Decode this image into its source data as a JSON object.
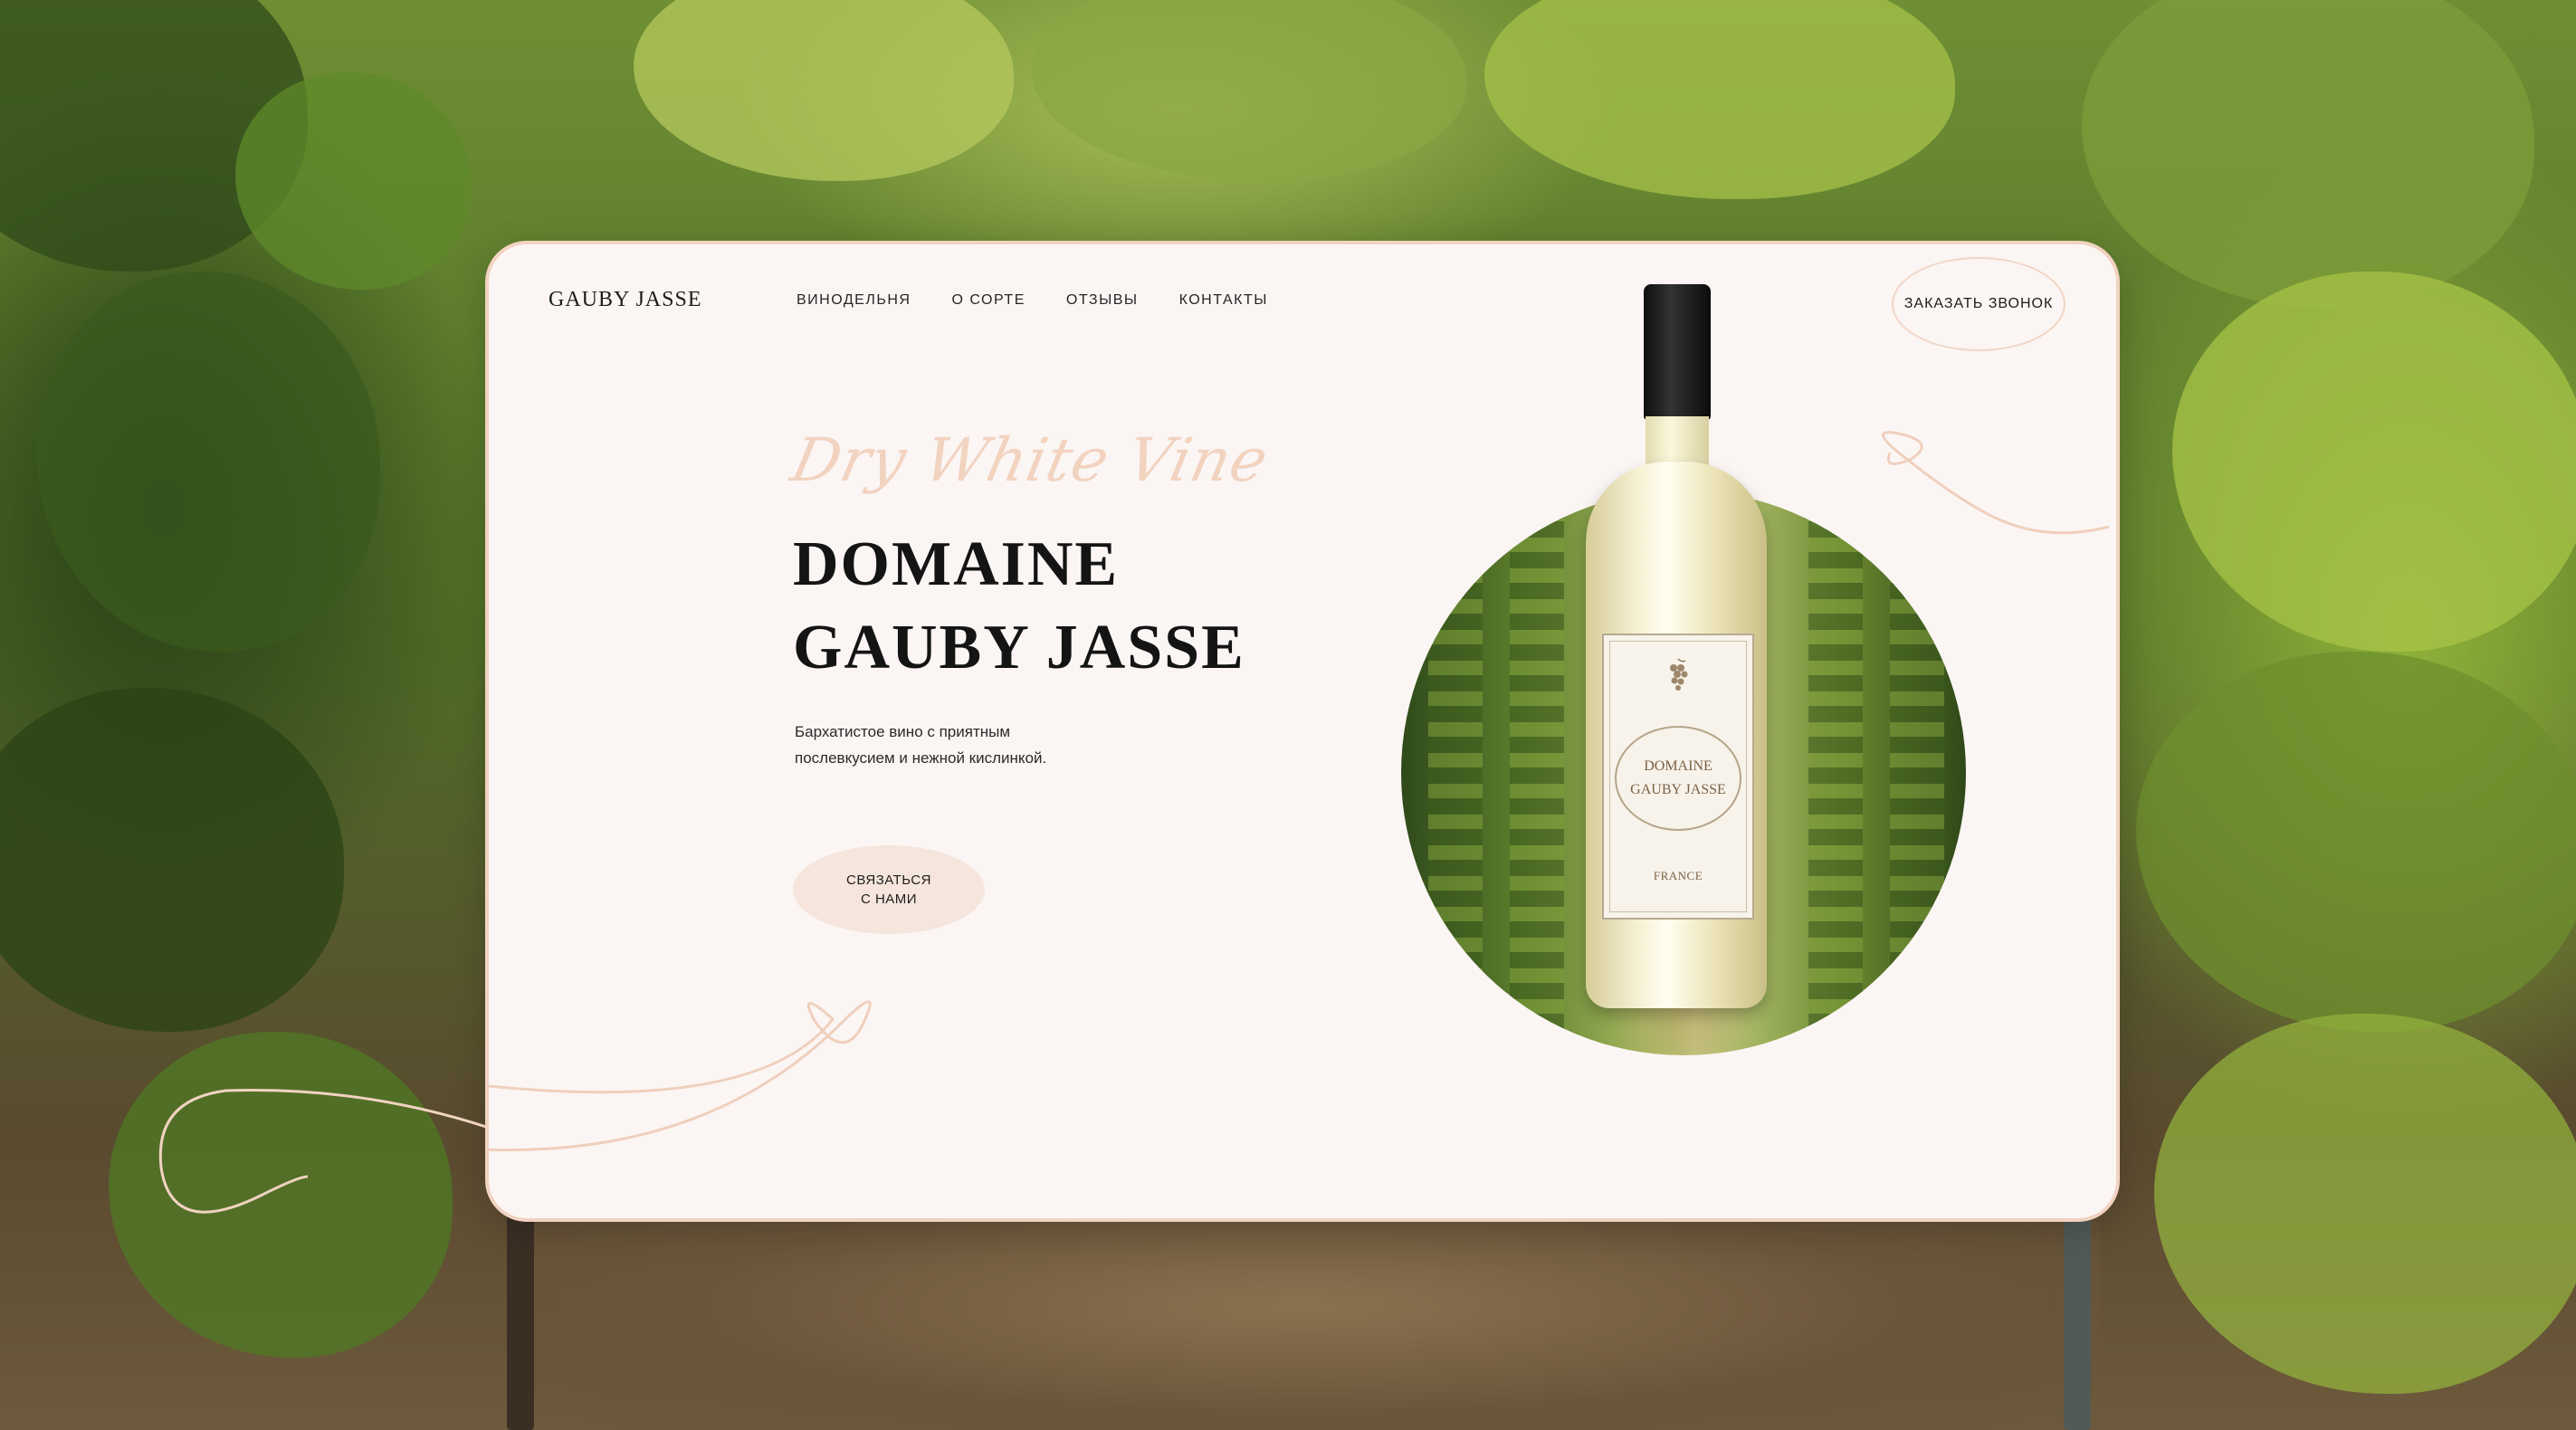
{
  "header": {
    "brand": "GAUBY JASSE",
    "nav": [
      "ВИНОДЕЛЬНЯ",
      "О СОРТЕ",
      "ОТЗЫВЫ",
      "КОНТАКТЫ"
    ],
    "call_button": "ЗАКАЗАТЬ ЗВОНОК"
  },
  "hero": {
    "script_title": "Dry White Vine",
    "title_line1": "DOMAINE",
    "title_line2": "GAUBY JASSE",
    "description_line1": "Бархатистое вино  с приятным",
    "description_line2": "послевкусием  и нежной кислинкой.",
    "contact_button_line1": "СВЯЗАТЬСЯ",
    "contact_button_line2": "С НАМИ"
  },
  "bottle_label": {
    "name_line1": "DOMAINE",
    "name_line2": "GAUBY JASSE",
    "origin": "FRANCE"
  },
  "colors": {
    "card_background": "#fbf6f4",
    "accent_peach": "#f1d3c1",
    "button_fill": "#f5e5dc",
    "text_dark": "#141414"
  },
  "icons": {
    "bottle_grape": "grape-icon"
  }
}
